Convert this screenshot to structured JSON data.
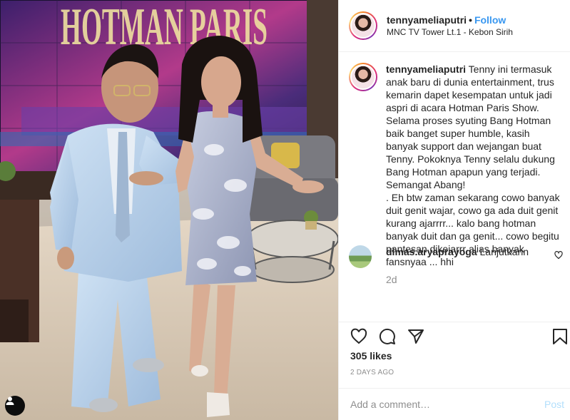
{
  "post": {
    "username": "tennyameliaputri",
    "follow_label": "Follow",
    "separator": "•",
    "location": "MNC TV Tower Lt.1 - Kebon Sirih",
    "photo_text": "HOTMAN PARIS",
    "caption": {
      "username": "tennyameliaputri",
      "text": "Tenny ini termasuk anak baru di dunia entertainment, trus kemarin dapet kesempatan untuk jadi aspri di acara Hotman Paris Show. Selama proses syuting Bang Hotman baik banget super humble, kasih banyak support dan wejangan buat Tenny. Pokoknya Tenny selalu dukung Bang Hotman apapun yang terjadi. Semangat Abang!\n. Eh btw zaman sekarang cowo banyak duit genit wajar, cowo ga ada duit genit kurang ajarrrr... kalo bang hotman banyak duit dan ga genit... cowo begitu pantesan dikejarrr alias banyak fansnyaa ... hhi",
      "time": "2d"
    },
    "comments": [
      {
        "username": "dimas.aryaprayoga",
        "text": "Lanjutkann"
      }
    ],
    "likes": "305 likes",
    "date": "2 DAYS AGO",
    "add_comment_placeholder": "Add a comment…",
    "post_label": "Post"
  },
  "icons": {
    "like": "heart-icon",
    "comment": "comment-icon",
    "share": "share-icon",
    "save": "bookmark-icon",
    "comment_like": "small-heart-icon",
    "tag": "user-tag-icon"
  },
  "colors": {
    "follow": "#3897f0",
    "muted": "#8e8e8e",
    "text": "#262626",
    "post_disabled": "#b2dffc",
    "divider": "#efefef"
  }
}
